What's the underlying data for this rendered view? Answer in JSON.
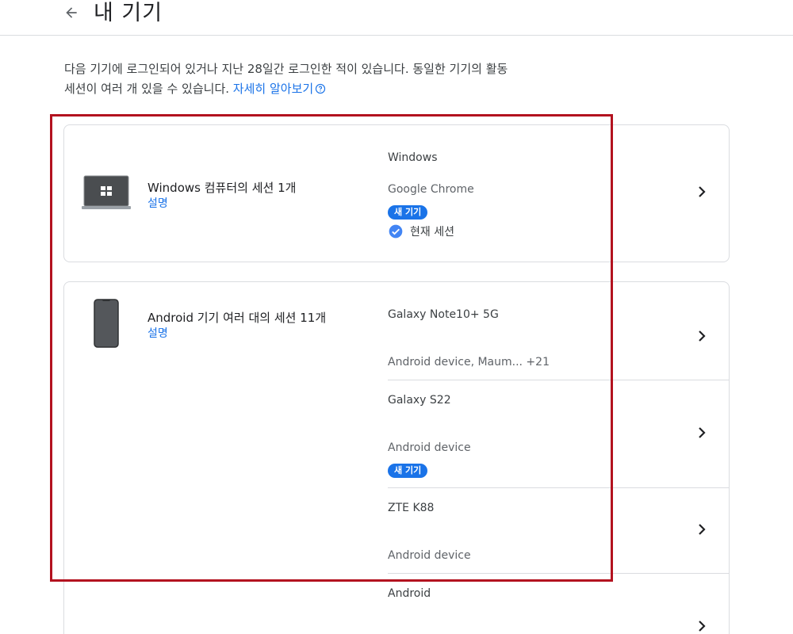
{
  "header": {
    "title": "내 기기"
  },
  "description": {
    "text": "다음 기기에 로그인되어 있거나 지난 28일간 로그인한 적이 있습니다. 동일한 기기의 활동 세션이 여러 개 있을 수 있습니다.",
    "learn_more": "자세히 알아보기"
  },
  "cards": [
    {
      "title": "Windows 컴퓨터의 세션 1개",
      "link": "설명",
      "devices": [
        {
          "name": "Windows",
          "detail": "Google Chrome",
          "badge": "새 기기",
          "current_session": "현재 세션"
        }
      ]
    },
    {
      "title": "Android 기기 여러 대의 세션 11개",
      "link": "설명",
      "devices": [
        {
          "name": "Galaxy Note10+ 5G",
          "detail": "Android device, Maum... +21"
        },
        {
          "name": "Galaxy S22",
          "detail": "Android device",
          "badge": "새 기기"
        },
        {
          "name": "ZTE K88",
          "detail": "Android device"
        },
        {
          "name": "Android"
        }
      ]
    }
  ],
  "colors": {
    "accent": "#1a73e8",
    "highlight_border": "#b3121f"
  },
  "icons": [
    "back-arrow-icon",
    "help-circle-icon",
    "laptop-windows-icon",
    "phone-icon",
    "check-circle-icon",
    "chevron-right-icon"
  ]
}
